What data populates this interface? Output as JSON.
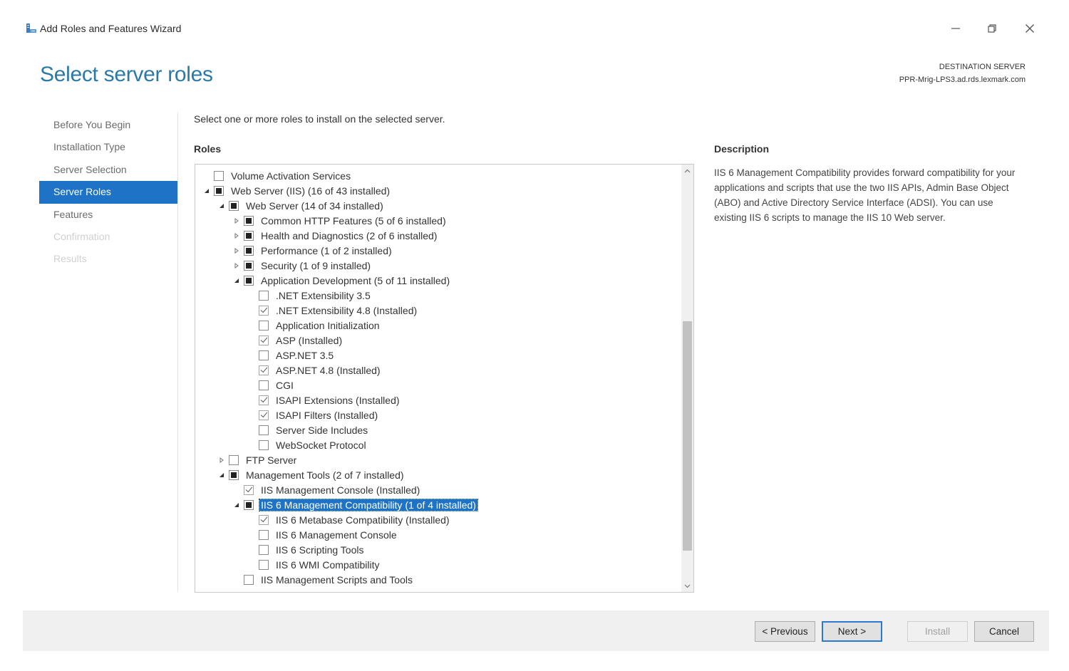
{
  "window": {
    "title": "Add Roles and Features Wizard",
    "page_title": "Select server roles",
    "destination_label": "DESTINATION SERVER",
    "destination_server": "PPR-Mrig-LPS3.ad.rds.lexmark.com"
  },
  "nav": {
    "items": [
      {
        "label": "Before You Begin",
        "state": "normal"
      },
      {
        "label": "Installation Type",
        "state": "normal"
      },
      {
        "label": "Server Selection",
        "state": "normal"
      },
      {
        "label": "Server Roles",
        "state": "active"
      },
      {
        "label": "Features",
        "state": "normal"
      },
      {
        "label": "Confirmation",
        "state": "disabled"
      },
      {
        "label": "Results",
        "state": "disabled"
      }
    ]
  },
  "main": {
    "instruction": "Select one or more roles to install on the selected server.",
    "roles_label": "Roles",
    "description_label": "Description",
    "description_text": "IIS 6 Management Compatibility provides forward compatibility for your applications and scripts that use the two IIS APIs, Admin Base Object (ABO) and Active Directory Service Interface (ADSI). You can use existing IIS 6 scripts to manage the IIS 10 Web server."
  },
  "tree": [
    {
      "label": "Volume Activation Services",
      "level": 0,
      "expander": "none",
      "check": "unchecked"
    },
    {
      "label": "Web Server (IIS) (16 of 43 installed)",
      "level": 0,
      "expander": "expanded",
      "check": "partial"
    },
    {
      "label": "Web Server (14 of 34 installed)",
      "level": 1,
      "expander": "expanded",
      "check": "partial"
    },
    {
      "label": "Common HTTP Features (5 of 6 installed)",
      "level": 2,
      "expander": "collapsed",
      "check": "partial"
    },
    {
      "label": "Health and Diagnostics (2 of 6 installed)",
      "level": 2,
      "expander": "collapsed",
      "check": "partial"
    },
    {
      "label": "Performance (1 of 2 installed)",
      "level": 2,
      "expander": "collapsed",
      "check": "partial"
    },
    {
      "label": "Security (1 of 9 installed)",
      "level": 2,
      "expander": "collapsed",
      "check": "partial"
    },
    {
      "label": "Application Development (5 of 11 installed)",
      "level": 2,
      "expander": "expanded",
      "check": "partial"
    },
    {
      "label": ".NET Extensibility 3.5",
      "level": 3,
      "expander": "none",
      "check": "unchecked"
    },
    {
      "label": ".NET Extensibility 4.8 (Installed)",
      "level": 3,
      "expander": "none",
      "check": "checked"
    },
    {
      "label": "Application Initialization",
      "level": 3,
      "expander": "none",
      "check": "unchecked"
    },
    {
      "label": "ASP (Installed)",
      "level": 3,
      "expander": "none",
      "check": "checked"
    },
    {
      "label": "ASP.NET 3.5",
      "level": 3,
      "expander": "none",
      "check": "unchecked"
    },
    {
      "label": "ASP.NET 4.8 (Installed)",
      "level": 3,
      "expander": "none",
      "check": "checked"
    },
    {
      "label": "CGI",
      "level": 3,
      "expander": "none",
      "check": "unchecked"
    },
    {
      "label": "ISAPI Extensions (Installed)",
      "level": 3,
      "expander": "none",
      "check": "checked"
    },
    {
      "label": "ISAPI Filters (Installed)",
      "level": 3,
      "expander": "none",
      "check": "checked"
    },
    {
      "label": "Server Side Includes",
      "level": 3,
      "expander": "none",
      "check": "unchecked"
    },
    {
      "label": "WebSocket Protocol",
      "level": 3,
      "expander": "none",
      "check": "unchecked"
    },
    {
      "label": "FTP Server",
      "level": 1,
      "expander": "collapsed",
      "check": "unchecked"
    },
    {
      "label": "Management Tools (2 of 7 installed)",
      "level": 1,
      "expander": "expanded",
      "check": "partial"
    },
    {
      "label": "IIS Management Console (Installed)",
      "level": 2,
      "expander": "none",
      "check": "checked"
    },
    {
      "label": "IIS 6 Management Compatibility (1 of 4 installed)",
      "level": 2,
      "expander": "expanded",
      "check": "partial",
      "selected": true
    },
    {
      "label": "IIS 6 Metabase Compatibility (Installed)",
      "level": 3,
      "expander": "none",
      "check": "checked"
    },
    {
      "label": "IIS 6 Management Console",
      "level": 3,
      "expander": "none",
      "check": "unchecked"
    },
    {
      "label": "IIS 6 Scripting Tools",
      "level": 3,
      "expander": "none",
      "check": "unchecked"
    },
    {
      "label": "IIS 6 WMI Compatibility",
      "level": 3,
      "expander": "none",
      "check": "unchecked"
    },
    {
      "label": "IIS Management Scripts and Tools",
      "level": 2,
      "expander": "none",
      "check": "unchecked"
    }
  ],
  "footer": {
    "previous_label": "< Previous",
    "next_label": "Next >",
    "install_label": "Install",
    "cancel_label": "Cancel"
  },
  "icons": {
    "expanded": "triangle-down-right-icon",
    "collapsed": "triangle-right-icon",
    "minimize": "minimize-icon",
    "restore": "restore-icon",
    "close": "close-icon"
  },
  "colors": {
    "title_blue": "#2b7aa6",
    "selection_blue": "#1e73c6"
  }
}
